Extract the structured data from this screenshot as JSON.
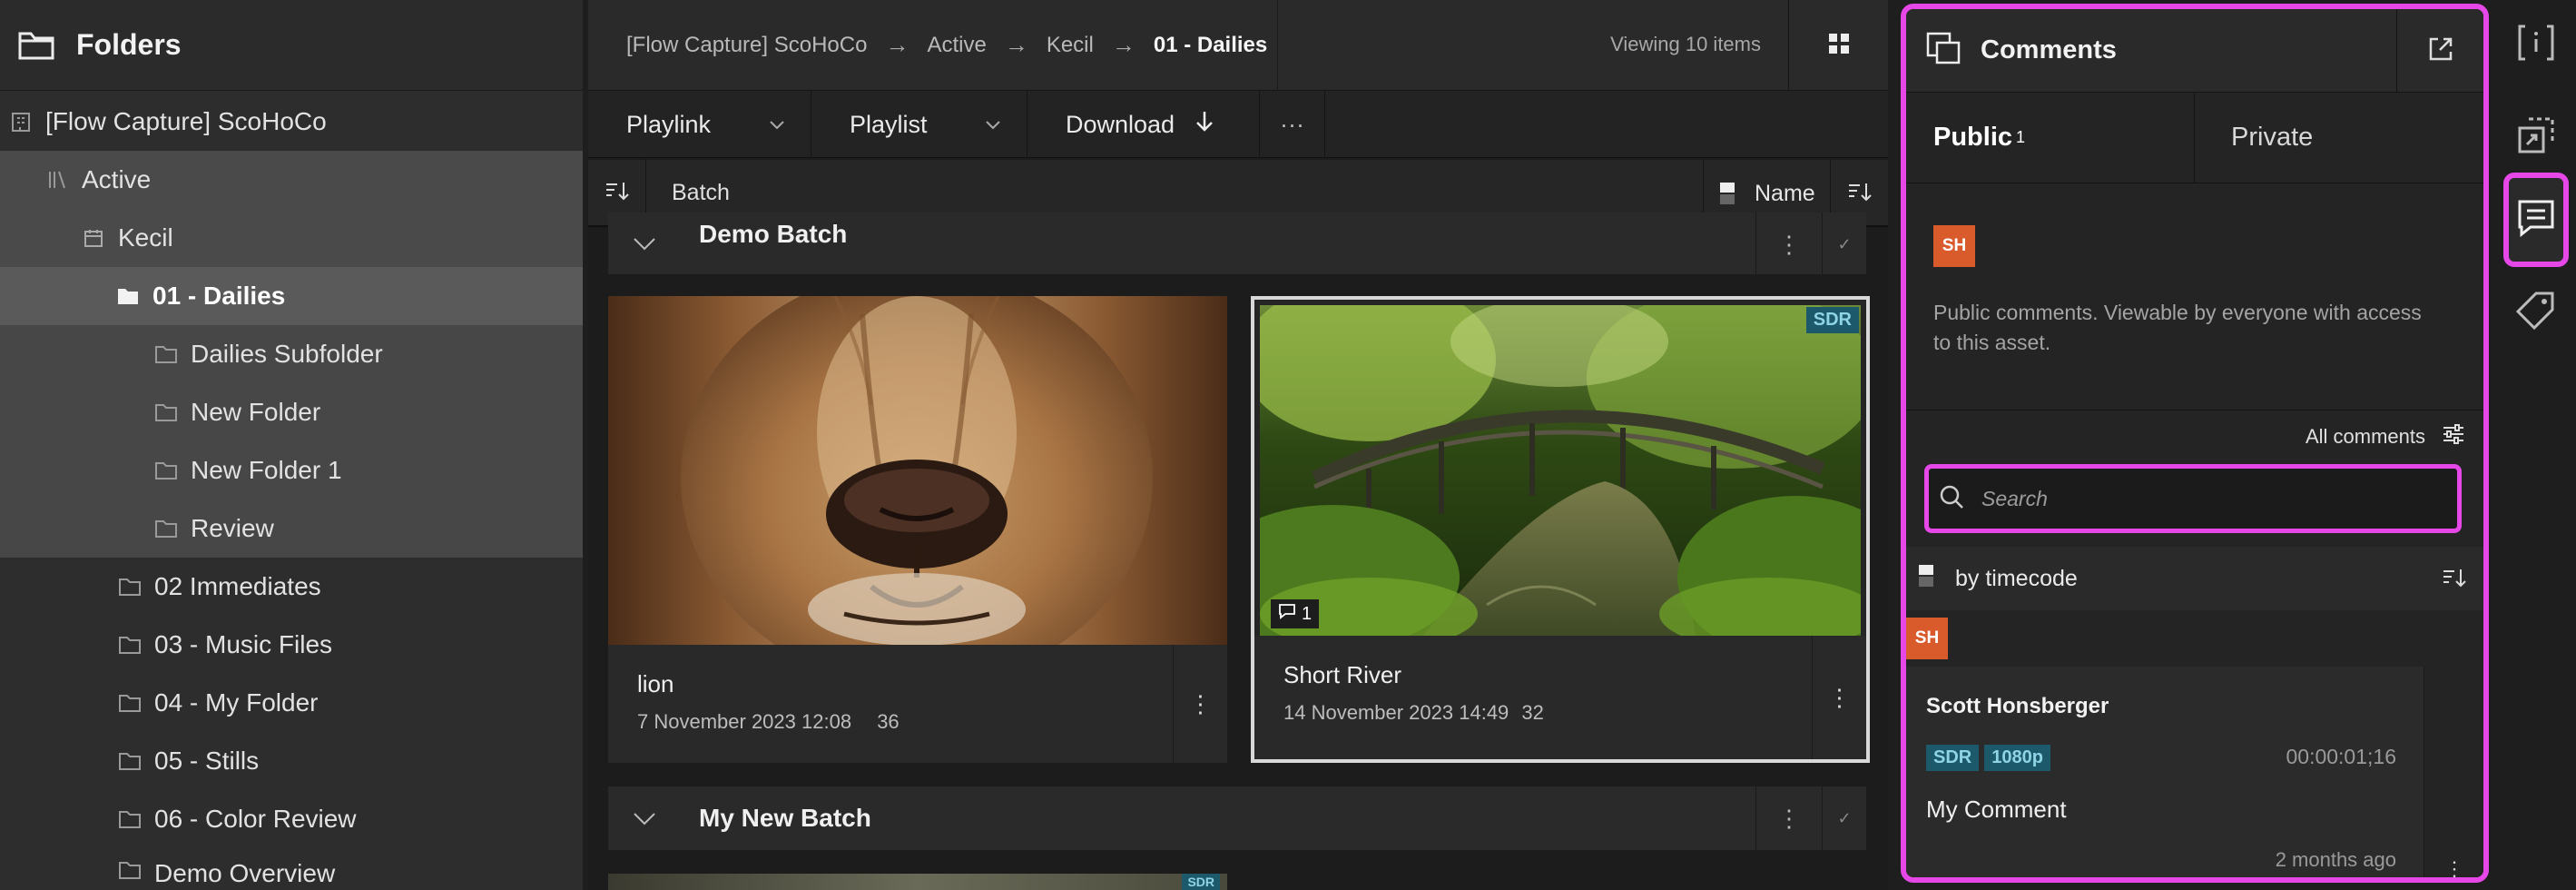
{
  "folders": {
    "title": "Folders",
    "items": [
      {
        "label": "[Flow Capture] ScoHoCo",
        "icon": "building-icon"
      },
      {
        "label": "Active",
        "icon": "library-icon"
      },
      {
        "label": "Kecil",
        "icon": "calendar-icon"
      },
      {
        "label": "01 - Dailies",
        "icon": "folder-filled-icon"
      },
      {
        "label": "Dailies Subfolder",
        "icon": "folder-icon"
      },
      {
        "label": "New Folder",
        "icon": "folder-icon"
      },
      {
        "label": "New Folder 1",
        "icon": "folder-icon"
      },
      {
        "label": "Review",
        "icon": "folder-icon"
      },
      {
        "label": "02 Immediates",
        "icon": "folder-icon"
      },
      {
        "label": "03 - Music Files",
        "icon": "folder-icon"
      },
      {
        "label": "04 - My Folder",
        "icon": "folder-icon"
      },
      {
        "label": "05 - Stills",
        "icon": "folder-icon"
      },
      {
        "label": "06 - Color Review",
        "icon": "folder-icon"
      },
      {
        "label": "Demo Overview",
        "icon": "folder-icon"
      }
    ]
  },
  "breadcrumb": {
    "items": [
      "[Flow Capture] ScoHoCo",
      "Active",
      "Kecil",
      "01 - Dailies"
    ],
    "viewing": "Viewing 10 items"
  },
  "toolbar": {
    "playlink": "Playlink",
    "playlist": "Playlist",
    "download": "Download",
    "more": "···"
  },
  "sortbar": {
    "batch": "Batch",
    "name": "Name"
  },
  "batches": [
    {
      "name": "Demo Batch"
    },
    {
      "name": "My New Batch"
    }
  ],
  "assets": [
    {
      "title": "lion",
      "date": "7 November 2023 12:08",
      "count": "36"
    },
    {
      "title": "Short River",
      "date": "14 November 2023 14:49",
      "count": "32",
      "badge": "SDR",
      "comments": "1"
    }
  ],
  "third_badge": "SDR",
  "comments_panel": {
    "title": "Comments",
    "tabs": {
      "public": "Public",
      "public_count": "1",
      "private": "Private"
    },
    "compose_avatar": "SH",
    "compose_hint": "Public comments. Viewable by everyone with access to this asset.",
    "all_comments": "All comments",
    "search_placeholder": "Search",
    "sort_label": "by timecode",
    "comment": {
      "avatar": "SH",
      "author": "Scott Honsberger",
      "tags": [
        "SDR",
        "1080p"
      ],
      "timecode": "00:00:01;16",
      "body": "My Comment",
      "ago": "2 months ago"
    }
  },
  "colors": {
    "highlight": "#e648e8",
    "avatar": "#d95a2b",
    "tag_bg": "#1c5a6b"
  }
}
